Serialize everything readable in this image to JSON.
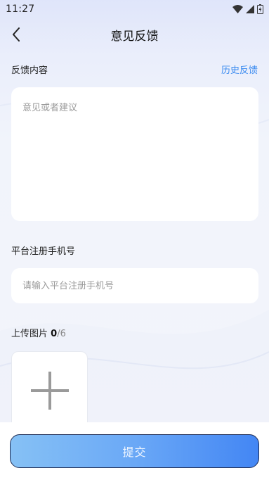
{
  "status_bar": {
    "time": "11:27",
    "icons": [
      "wifi-icon",
      "cellular-signal-icon",
      "battery-icon"
    ]
  },
  "nav": {
    "title": "意见反馈",
    "back_icon": "chevron-left-icon"
  },
  "feedback": {
    "label": "反馈内容",
    "history_link": "历史反馈",
    "placeholder": "意见或者建议"
  },
  "phone": {
    "label": "平台注册手机号",
    "placeholder": "请输入平台注册手机号"
  },
  "upload": {
    "label": "上传图片",
    "count": "0",
    "total": "/6",
    "add_icon": "plus-icon"
  },
  "submit_label": "提交",
  "colors": {
    "accent": "#3b8bf0",
    "button_start": "#86c1f5",
    "button_end": "#4386f4"
  }
}
